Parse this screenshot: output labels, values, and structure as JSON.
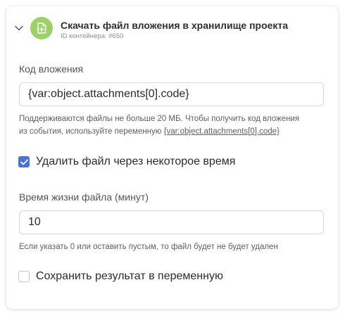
{
  "header": {
    "title": "Скачать файл вложения в хранилище проекта",
    "container_id": "ID контейнера: #650",
    "icon": "file-plus-icon",
    "accent_color": "#9bd266"
  },
  "attachment_code": {
    "label": "Код вложения",
    "value": "{var:object.attachments[0].code}",
    "hint_line1": "Поддерживаются файлы не больше 20 МБ. Чтобы получить код вложения",
    "hint_line2_prefix": "из события, используйте переменную ",
    "hint_variable": "{var:object.attachments[0].code}"
  },
  "delete_after": {
    "label": "Удалить файл через некоторое время",
    "checked": true,
    "checkbox_color": "#4a72d6"
  },
  "lifetime": {
    "label": "Время жизни файла (минут)",
    "value": "10",
    "hint": "Если указать 0 или оставить пустым, то файл будет не будет удален"
  },
  "save_result": {
    "label": "Сохранить результат в переменную",
    "checked": false
  }
}
